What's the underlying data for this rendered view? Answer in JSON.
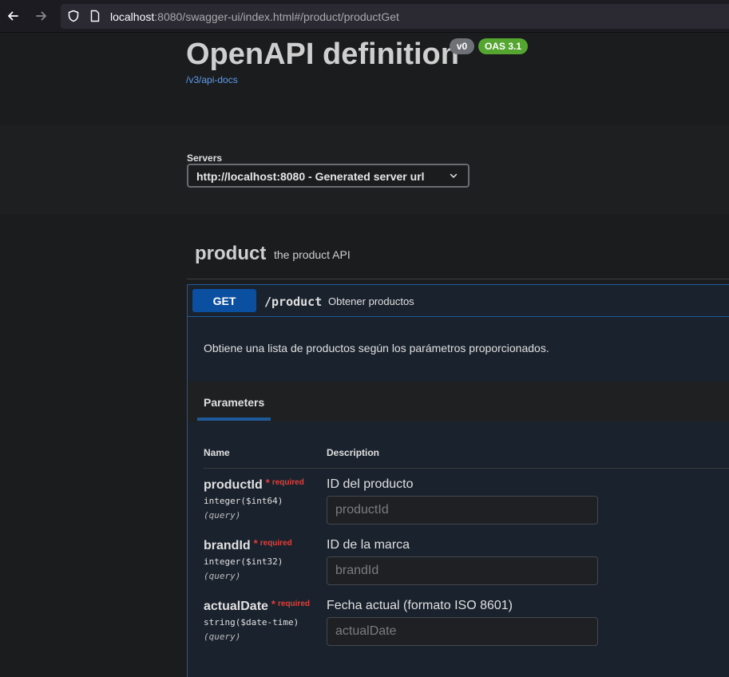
{
  "browser": {
    "url_host": "localhost",
    "url_rest": ":8080/swagger-ui/index.html#/product/productGet"
  },
  "info": {
    "title": "OpenAPI definition",
    "version_badge": "v0",
    "oas_badge": "OAS 3.1",
    "api_docs_link": "/v3/api-docs"
  },
  "servers": {
    "label": "Servers",
    "selected": "http://localhost:8080 - Generated server url"
  },
  "tag": {
    "name": "product",
    "description": "the product API"
  },
  "operation": {
    "method": "GET",
    "path": "/product",
    "summary": "Obtener productos",
    "description": "Obtiene una lista de productos según los parámetros proporcionados.",
    "parameters_tab": "Parameters",
    "col_name": "Name",
    "col_description": "Description",
    "required_star": "*",
    "required_text": "required",
    "parameters": [
      {
        "name": "productId",
        "type": "integer($int64)",
        "in": "(query)",
        "description": "ID del producto",
        "placeholder": "productId"
      },
      {
        "name": "brandId",
        "type": "integer($int32)",
        "in": "(query)",
        "description": "ID de la marca",
        "placeholder": "brandId"
      },
      {
        "name": "actualDate",
        "type": "string($date-time)",
        "in": "(query)",
        "description": "Fecha actual (formato ISO 8601)",
        "placeholder": "actualDate"
      }
    ]
  },
  "colors": {
    "get_method": "#0b4fa0",
    "oas_badge": "#55a630",
    "required": "#e0403a",
    "link": "#5c9df0"
  }
}
